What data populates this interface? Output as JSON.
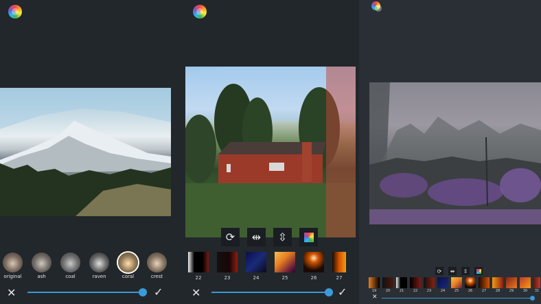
{
  "screens": {
    "left": {
      "filters": [
        {
          "label": "original"
        },
        {
          "label": "ash"
        },
        {
          "label": "coal"
        },
        {
          "label": "raven"
        },
        {
          "label": "coral"
        },
        {
          "label": "crest"
        }
      ],
      "selected_filter": "coral",
      "slider_value_percent": 100
    },
    "middle": {
      "tools": [
        {
          "icon": "rotate-icon",
          "glyph": "⟳"
        },
        {
          "icon": "flip-horizontal-icon",
          "glyph": "⇹"
        },
        {
          "icon": "flip-vertical-icon",
          "glyph": "⇳"
        },
        {
          "icon": "color-grid-icon",
          "glyph": "■"
        }
      ],
      "filters": [
        {
          "label": "22"
        },
        {
          "label": "23"
        },
        {
          "label": "24"
        },
        {
          "label": "25"
        },
        {
          "label": "26"
        },
        {
          "label": "27"
        }
      ],
      "slider_value_percent": 100
    },
    "right": {
      "tools": [
        {
          "icon": "rotate-icon",
          "glyph": "⟳"
        },
        {
          "icon": "flip-horizontal-icon",
          "glyph": "⇹"
        },
        {
          "icon": "flip-vertical-icon",
          "glyph": "⇳"
        },
        {
          "icon": "color-grid-icon",
          "glyph": "■"
        }
      ],
      "filters": [
        {
          "label": "19"
        },
        {
          "label": "20"
        },
        {
          "label": "21"
        },
        {
          "label": "22"
        },
        {
          "label": "23"
        },
        {
          "label": "24"
        },
        {
          "label": "25"
        },
        {
          "label": "26"
        },
        {
          "label": "27"
        },
        {
          "label": "28"
        },
        {
          "label": "29"
        },
        {
          "label": "30"
        },
        {
          "label": "31"
        }
      ],
      "slider_value_percent": 100
    }
  },
  "colors": {
    "background": "#22272c",
    "accent": "#3a9bd8",
    "text": "#e6e6e6"
  }
}
